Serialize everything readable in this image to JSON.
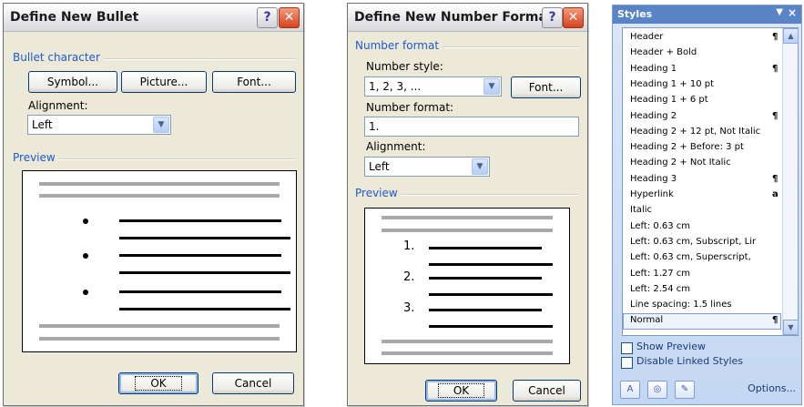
{
  "bullet_dialog": {
    "title": "Define New Bullet",
    "help": "?",
    "close": "✕",
    "group_bullet": "Bullet character",
    "symbol_btn": "Symbol...",
    "picture_btn": "Picture...",
    "font_btn": "Font...",
    "alignment_label": "Alignment:",
    "alignment_value": "Left",
    "group_preview": "Preview",
    "ok": "OK",
    "cancel": "Cancel"
  },
  "number_dialog": {
    "title": "Define New Number Format",
    "help": "?",
    "close": "✕",
    "group_format": "Number format",
    "style_label": "Number style:",
    "style_value": "1, 2, 3, ...",
    "font_btn": "Font...",
    "format_label": "Number format:",
    "format_value": "1.",
    "alignment_label": "Alignment:",
    "alignment_value": "Left",
    "group_preview": "Preview",
    "preview_numbers": [
      "1.",
      "2.",
      "3."
    ],
    "ok": "OK",
    "cancel": "Cancel"
  },
  "styles_pane": {
    "title": "Styles",
    "items": [
      {
        "label": "Header",
        "sym": "¶"
      },
      {
        "label": "Header + Bold",
        "sym": ""
      },
      {
        "label": "Heading 1",
        "sym": "¶"
      },
      {
        "label": "Heading 1 + 10 pt",
        "sym": ""
      },
      {
        "label": "Heading 1 + 6 pt",
        "sym": ""
      },
      {
        "label": "Heading 2",
        "sym": "¶"
      },
      {
        "label": "Heading 2 + 12 pt, Not Italic",
        "sym": ""
      },
      {
        "label": "Heading 2 + Before:  3 pt",
        "sym": ""
      },
      {
        "label": "Heading 2 + Not Italic",
        "sym": ""
      },
      {
        "label": "Heading 3",
        "sym": "¶"
      },
      {
        "label": "Hyperlink",
        "sym": "a"
      },
      {
        "label": "Italic",
        "sym": ""
      },
      {
        "label": "Left:  0.63 cm",
        "sym": ""
      },
      {
        "label": "Left:  0.63 cm, Subscript, Lir",
        "sym": ""
      },
      {
        "label": "Left:  0.63 cm, Superscript,",
        "sym": ""
      },
      {
        "label": "Left:  1.27 cm",
        "sym": ""
      },
      {
        "label": "Left:  2.54 cm",
        "sym": ""
      },
      {
        "label": "Line spacing:  1.5 lines",
        "sym": ""
      },
      {
        "label": "Normal",
        "sym": "¶"
      }
    ],
    "show_preview": "Show Preview",
    "disable_linked": "Disable Linked Styles",
    "options": "Options..."
  }
}
